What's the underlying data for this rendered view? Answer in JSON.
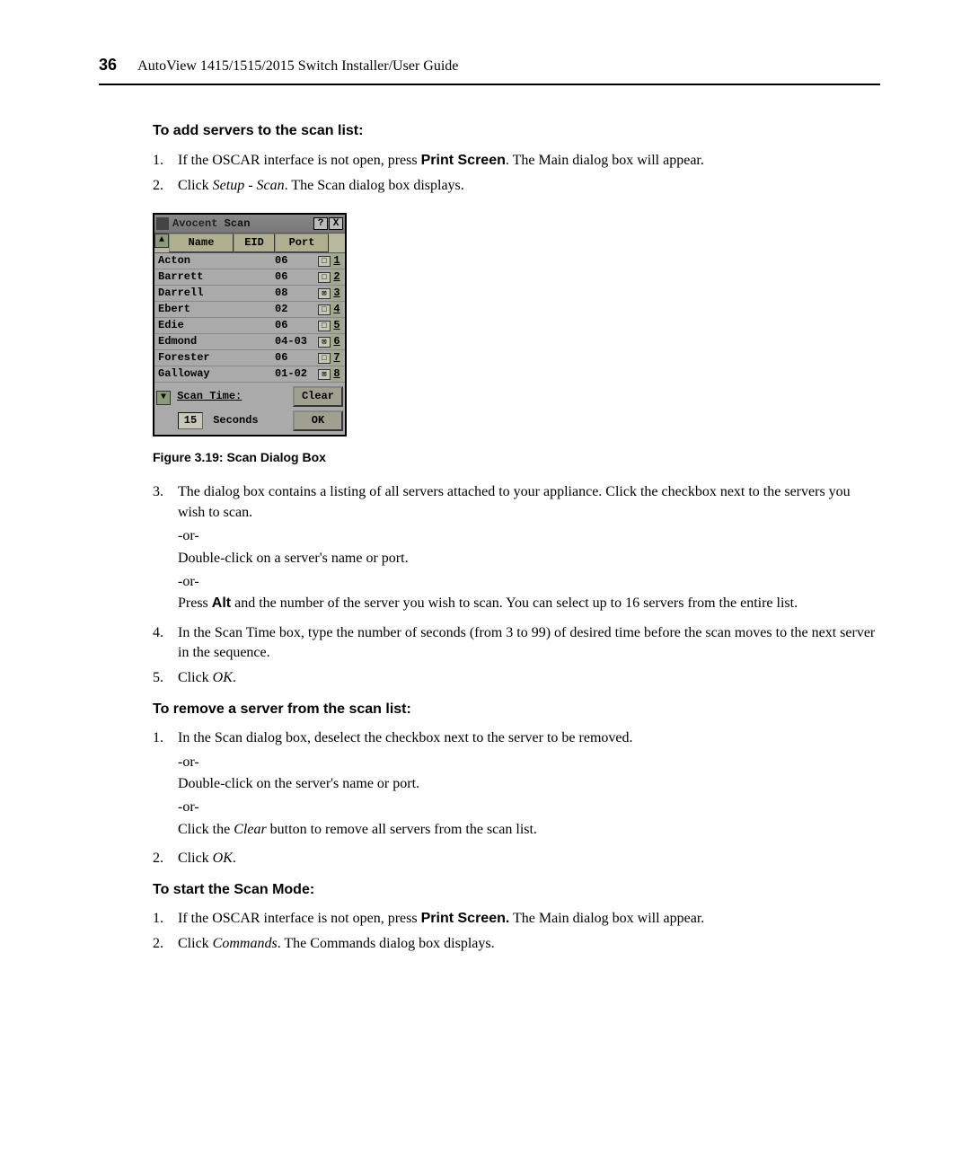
{
  "header": {
    "page_number": "36",
    "doc_title": "AutoView 1415/1515/2015 Switch Installer/User Guide"
  },
  "sections": {
    "add_servers": {
      "heading": "To add servers to the scan list:",
      "step1_pre": "If the OSCAR interface is not open, press ",
      "step1_bold": "Print Screen",
      "step1_post": ". The Main dialog box will appear.",
      "step2_pre": "Click ",
      "step2_italic": "Setup - Scan",
      "step2_post": ". The Scan dialog box displays."
    },
    "figure_caption": "Figure 3.19: Scan Dialog Box",
    "step3": {
      "line1": "The dialog box contains a listing of all servers attached to your appliance. Click the checkbox next to the servers you wish to scan.",
      "or1": "-or-",
      "line2": "Double-click on a server's name or port.",
      "or2": "-or-",
      "line3_pre": "Press ",
      "line3_bold": "Alt",
      "line3_post": " and the number of the server you wish to scan. You can select up to 16 servers from the entire list."
    },
    "step4": "In the Scan Time box, type the number of seconds (from 3 to 99) of desired time before the scan moves to the next server in the sequence.",
    "step5_pre": "Click ",
    "step5_italic": "OK",
    "step5_post": ".",
    "remove_server": {
      "heading": "To remove a server from the scan list:",
      "step1_line1": "In the Scan dialog box, deselect the checkbox next to the server to be removed.",
      "or1": "-or-",
      "step1_line2": "Double-click on the server's name or port.",
      "or2": "-or-",
      "step1_line3_pre": "Click the ",
      "step1_line3_italic": "Clear",
      "step1_line3_post": " button to remove all servers from the scan list.",
      "step2_pre": "Click ",
      "step2_italic": "OK",
      "step2_post": "."
    },
    "start_scan": {
      "heading": "To start the Scan Mode:",
      "step1_pre": "If the OSCAR interface is not open, press ",
      "step1_bold": "Print Screen.",
      "step1_post": " The Main dialog box will appear.",
      "step2_pre": "Click ",
      "step2_italic": "Commands",
      "step2_post": ". The Commands dialog box displays."
    }
  },
  "dialog": {
    "title_brand": "Avocent",
    "title_name": "Scan",
    "help_btn": "?",
    "close_btn": "X",
    "cols": {
      "name": "Name",
      "eid": "EID",
      "port": "Port"
    },
    "rows": [
      {
        "name": "Acton",
        "port": "06",
        "checked": false,
        "num": "1"
      },
      {
        "name": "Barrett",
        "port": "06",
        "checked": false,
        "num": "2"
      },
      {
        "name": "Darrell",
        "port": "08",
        "checked": true,
        "num": "3"
      },
      {
        "name": "Ebert",
        "port": "02",
        "checked": false,
        "num": "4"
      },
      {
        "name": "Edie",
        "port": "06",
        "checked": false,
        "num": "5"
      },
      {
        "name": "Edmond",
        "port": "04-03",
        "checked": true,
        "num": "6"
      },
      {
        "name": "Forester",
        "port": "06",
        "checked": false,
        "num": "7"
      },
      {
        "name": "Galloway",
        "port": "01-02",
        "checked": true,
        "num": "8"
      }
    ],
    "scan_time_label": "Scan Time:",
    "scan_time_value": "15",
    "seconds_label": "Seconds",
    "clear_btn": "Clear",
    "ok_btn": "OK"
  }
}
